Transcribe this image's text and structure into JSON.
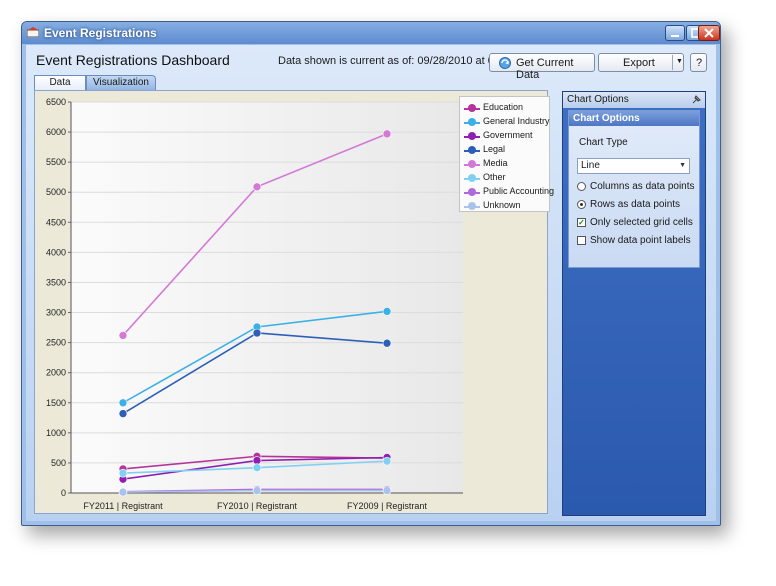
{
  "window": {
    "title": "Event Registrations"
  },
  "header": {
    "dashboard_title": "Event Registrations Dashboard",
    "as_of": "Data shown is current as of: 09/28/2010 at 08:58 AM",
    "get_data_label": "Get Current Data",
    "export_label": "Export",
    "help_label": "?"
  },
  "tabs": [
    {
      "label": "Data"
    },
    {
      "label": "Visualization"
    }
  ],
  "chart_options": {
    "panel_title": "Chart Options",
    "section_title": "Chart Options",
    "chart_type_label": "Chart Type",
    "chart_type_value": "Line",
    "radio_columns": "Columns as data points",
    "radio_rows": "Rows as data points",
    "check_selected": "Only selected grid cells",
    "check_labels": "Show data point labels",
    "radio_rows_selected": true,
    "check_selected_checked": true,
    "check_labels_checked": false
  },
  "chart_data": {
    "type": "line",
    "categories": [
      "FY2011 | Registrant",
      "FY2010 | Registrant",
      "FY2009 | Registrant"
    ],
    "ylim": [
      0,
      6500
    ],
    "yticks": [
      0,
      500,
      1000,
      1500,
      2000,
      2500,
      3000,
      3500,
      4000,
      4500,
      5000,
      5500,
      6000,
      6500
    ],
    "grid": true,
    "legend_position": "top-right",
    "series": [
      {
        "name": "Education",
        "color": "#b5339a",
        "values": [
          400,
          610,
          580
        ]
      },
      {
        "name": "General Industry",
        "color": "#3ab0e6",
        "values": [
          1500,
          2760,
          3020
        ]
      },
      {
        "name": "Government",
        "color": "#8e1fb0",
        "values": [
          230,
          540,
          590
        ]
      },
      {
        "name": "Legal",
        "color": "#2d5fb8",
        "values": [
          1320,
          2660,
          2490
        ]
      },
      {
        "name": "Media",
        "color": "#d27ad6",
        "values": [
          2620,
          5090,
          5970
        ]
      },
      {
        "name": "Other",
        "color": "#7fd0f3",
        "values": [
          330,
          420,
          530
        ]
      },
      {
        "name": "Public Accounting",
        "color": "#b069dd",
        "values": [
          20,
          60,
          60
        ]
      },
      {
        "name": "Unknown",
        "color": "#a9c3eb",
        "values": [
          15,
          40,
          40
        ]
      }
    ]
  }
}
